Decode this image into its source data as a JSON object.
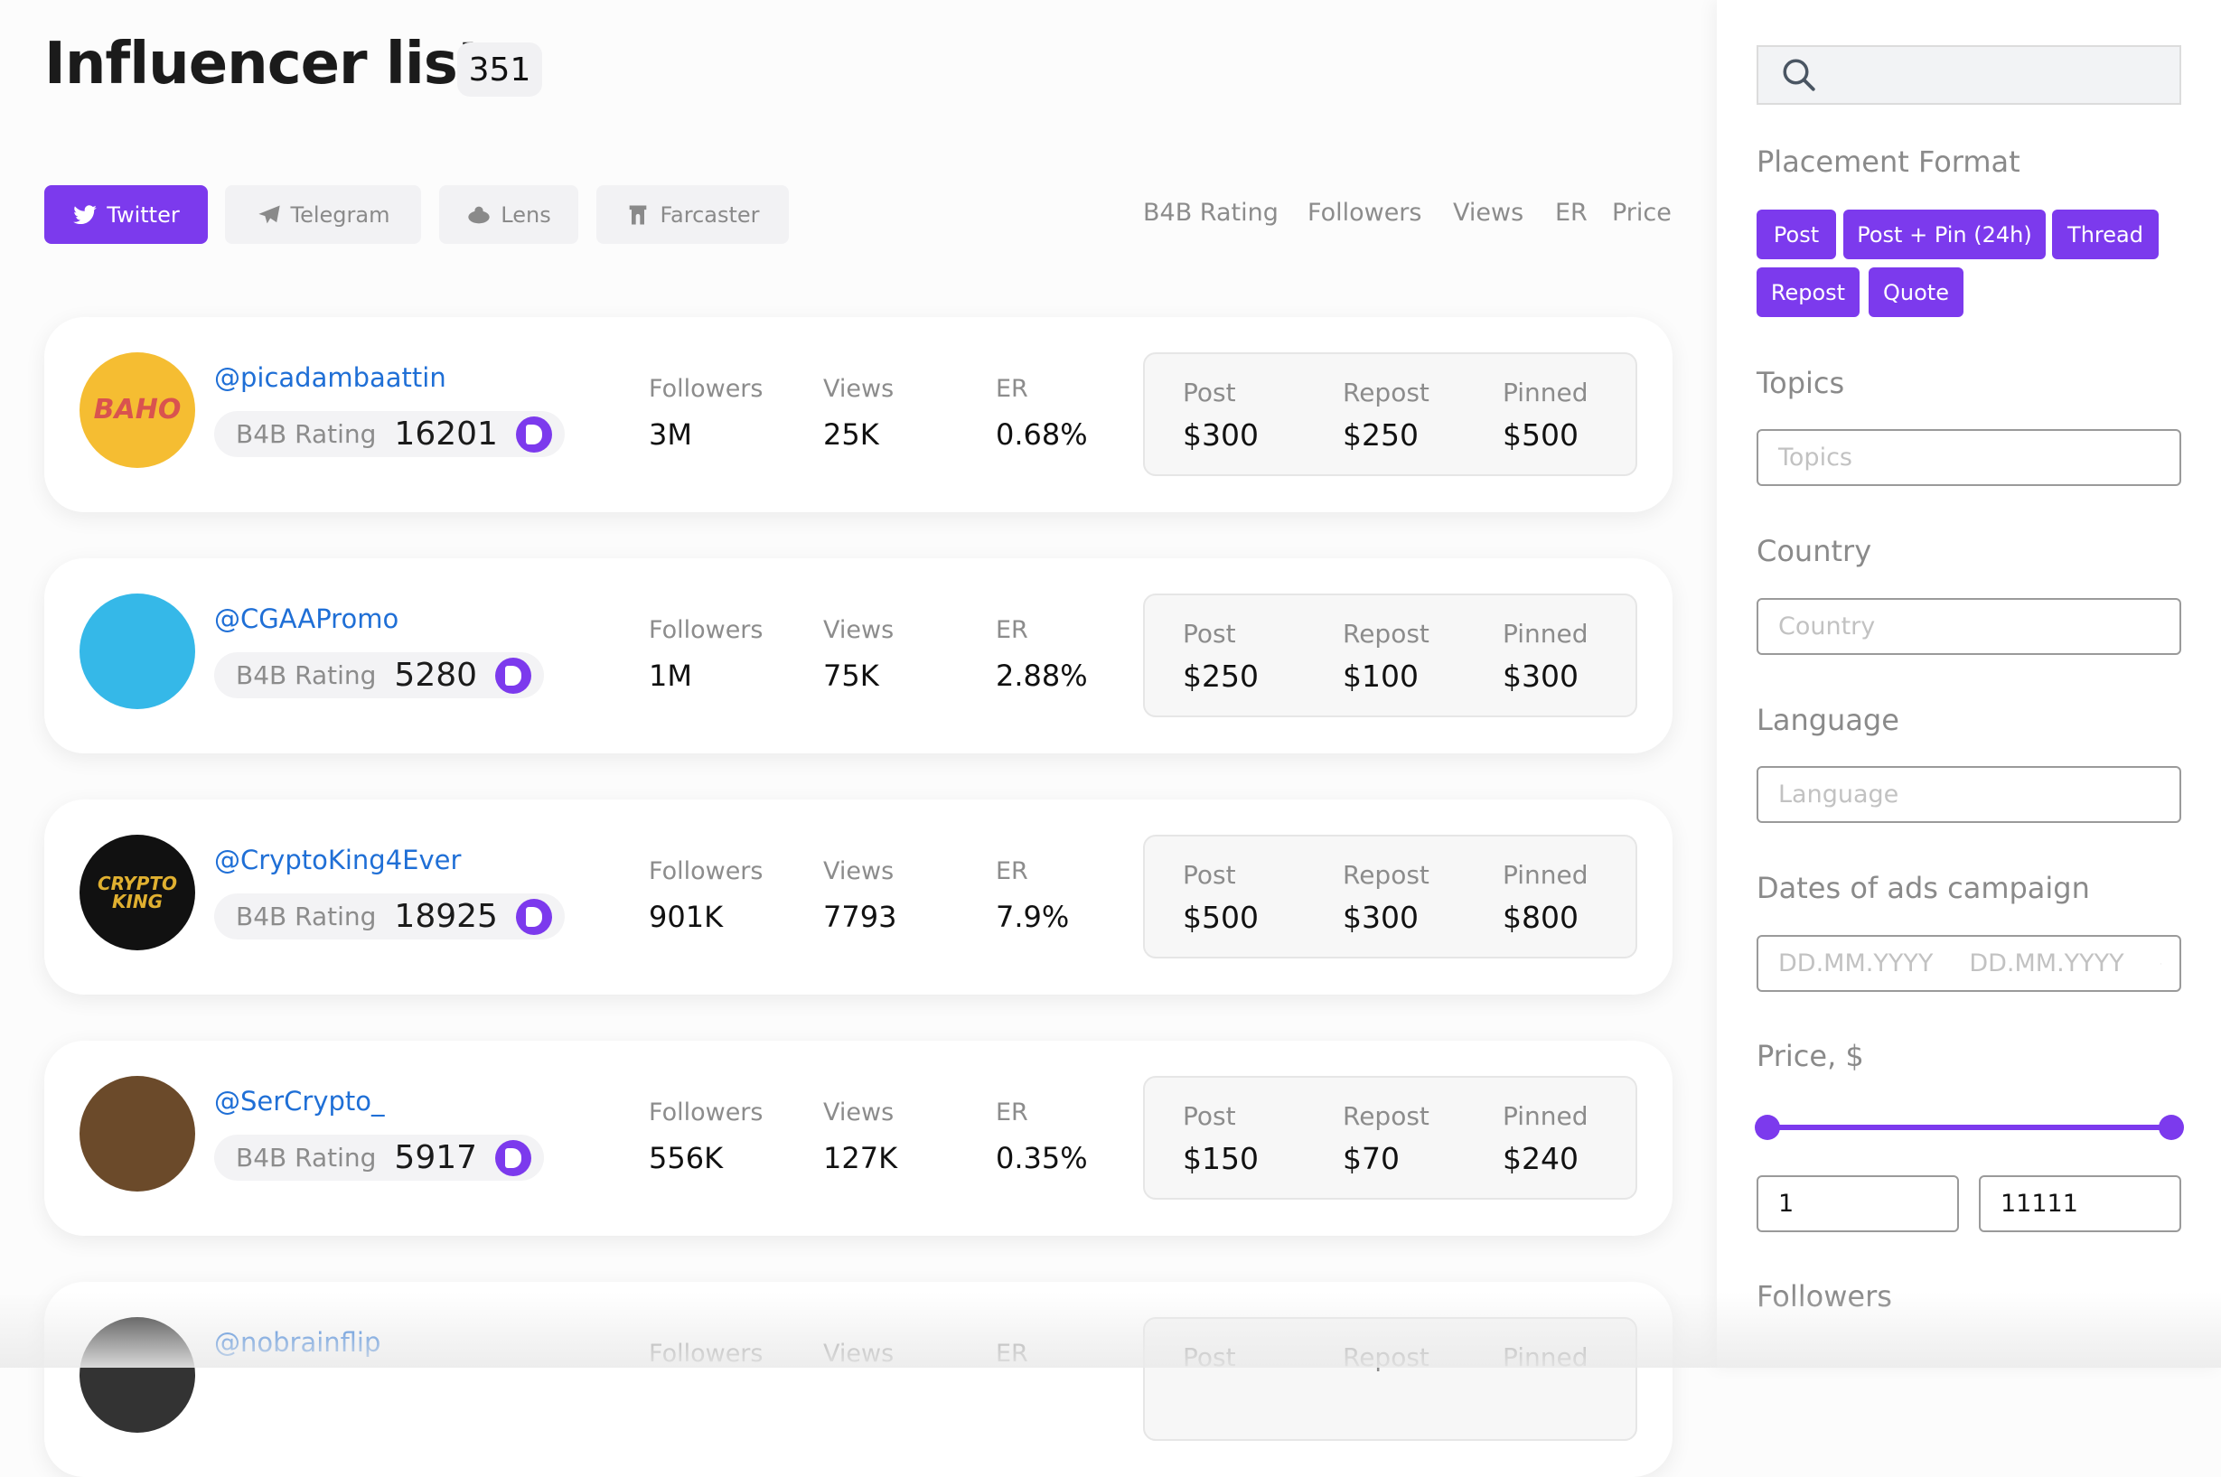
{
  "header": {
    "title": "Influencer list",
    "count": "351"
  },
  "tabs": [
    {
      "label": "Twitter",
      "icon": "twitter-bird-icon",
      "active": true
    },
    {
      "label": "Telegram",
      "icon": "paper-plane-icon"
    },
    {
      "label": "Lens",
      "icon": "lens-icon"
    },
    {
      "label": "Farcaster",
      "icon": "farcaster-arch-icon"
    }
  ],
  "sort": [
    "B4B Rating",
    "Followers",
    "Views",
    "ER",
    "Price"
  ],
  "labels": {
    "rating": "B4B Rating",
    "followers": "Followers",
    "views": "Views",
    "er": "ER",
    "post": "Post",
    "repost": "Repost",
    "pinned": "Pinned"
  },
  "influencers": [
    {
      "handle": "@picadambaattin",
      "rating": "16201",
      "followers": "3M",
      "views": "25K",
      "er": "0.68%",
      "post": "$300",
      "repost": "$250",
      "pinned": "$500",
      "avatar_color": "#f5bd32",
      "avatar_text": "BAHO"
    },
    {
      "handle": "@CGAAPromo",
      "rating": "5280",
      "followers": "1M",
      "views": "75K",
      "er": "2.88%",
      "post": "$250",
      "repost": "$100",
      "pinned": "$300",
      "avatar_color": "#35b8e8"
    },
    {
      "handle": "@CryptoKing4Ever",
      "rating": "18925",
      "followers": "901K",
      "views": "7793",
      "er": "7.9%",
      "post": "$500",
      "repost": "$300",
      "pinned": "$800",
      "avatar_color": "#111111",
      "avatar_text": "CRYPTO KING"
    },
    {
      "handle": "@SerCrypto_",
      "rating": "5917",
      "followers": "556K",
      "views": "127K",
      "er": "0.35%",
      "post": "$150",
      "repost": "$70",
      "pinned": "$240",
      "avatar_color": "#6b4a2a"
    },
    {
      "handle": "@nobrainflip",
      "rating": "",
      "followers": "",
      "views": "",
      "er": "",
      "post": "",
      "repost": "",
      "pinned": "",
      "avatar_color": "#333333"
    }
  ],
  "sidebar": {
    "search_placeholder": "",
    "placement_label": "Placement Format",
    "placements": [
      "Post",
      "Post + Pin (24h)",
      "Thread",
      "Repost",
      "Quote"
    ],
    "topics_label": "Topics",
    "topics_placeholder": "Topics",
    "country_label": "Country",
    "country_placeholder": "Country",
    "language_label": "Language",
    "language_placeholder": "Language",
    "dates_label": "Dates of ads campaign",
    "date_from_placeholder": "DD.MM.YYYY",
    "date_to_placeholder": "DD.MM.YYYY",
    "price_label": "Price, $",
    "price_min": "1",
    "price_max": "11111",
    "followers_label": "Followers"
  },
  "colors": {
    "accent": "#7c3aed",
    "link": "#1f6fd6"
  }
}
